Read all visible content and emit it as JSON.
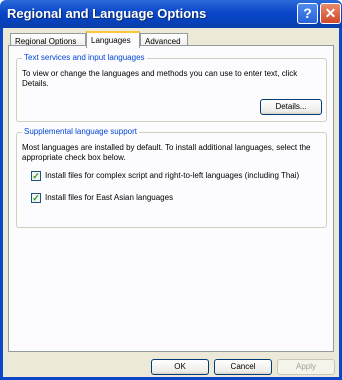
{
  "window": {
    "title": "Regional and Language Options",
    "help_glyph": "?",
    "close_glyph": "✕"
  },
  "tabs": [
    {
      "label": "Regional Options",
      "active": false
    },
    {
      "label": "Languages",
      "active": true
    },
    {
      "label": "Advanced",
      "active": false
    }
  ],
  "text_services": {
    "legend": "Text services and input languages",
    "description": "To view or change the languages and methods you can use to enter text, click Details.",
    "details_button": "Details..."
  },
  "supplemental": {
    "legend": "Supplemental language support",
    "description": "Most languages are installed by default. To install additional languages, select the appropriate check box below.",
    "checkboxes": [
      {
        "label": "Install files for complex script and right-to-left languages (including Thai)",
        "checked": true
      },
      {
        "label": "Install files for East Asian languages",
        "checked": true
      }
    ]
  },
  "footer": {
    "ok": "OK",
    "cancel": "Cancel",
    "apply": "Apply"
  },
  "colors": {
    "title_bar": "#0a46c8",
    "group_legend": "#0046d5",
    "dialog_face": "#ece9d8"
  }
}
